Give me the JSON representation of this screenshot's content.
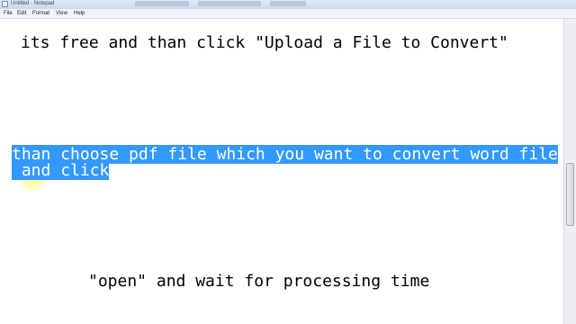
{
  "window": {
    "title": "Untitled - Notepad"
  },
  "menu": [
    "File",
    "Edit",
    "Format",
    "View",
    "Help"
  ],
  "editor": {
    "line1": "its free and than click \"Upload a File to Convert\"",
    "line2_selected": "than choose pdf file which you want to convert word file",
    "line3_prefix": " ",
    "line3_selected": "and click",
    "line4": "\"open\" and wait for processing time"
  },
  "colors": {
    "selection": "#3399ff",
    "cursor_highlight": "#ffff80"
  },
  "icons": {
    "app": "notepad-icon"
  }
}
